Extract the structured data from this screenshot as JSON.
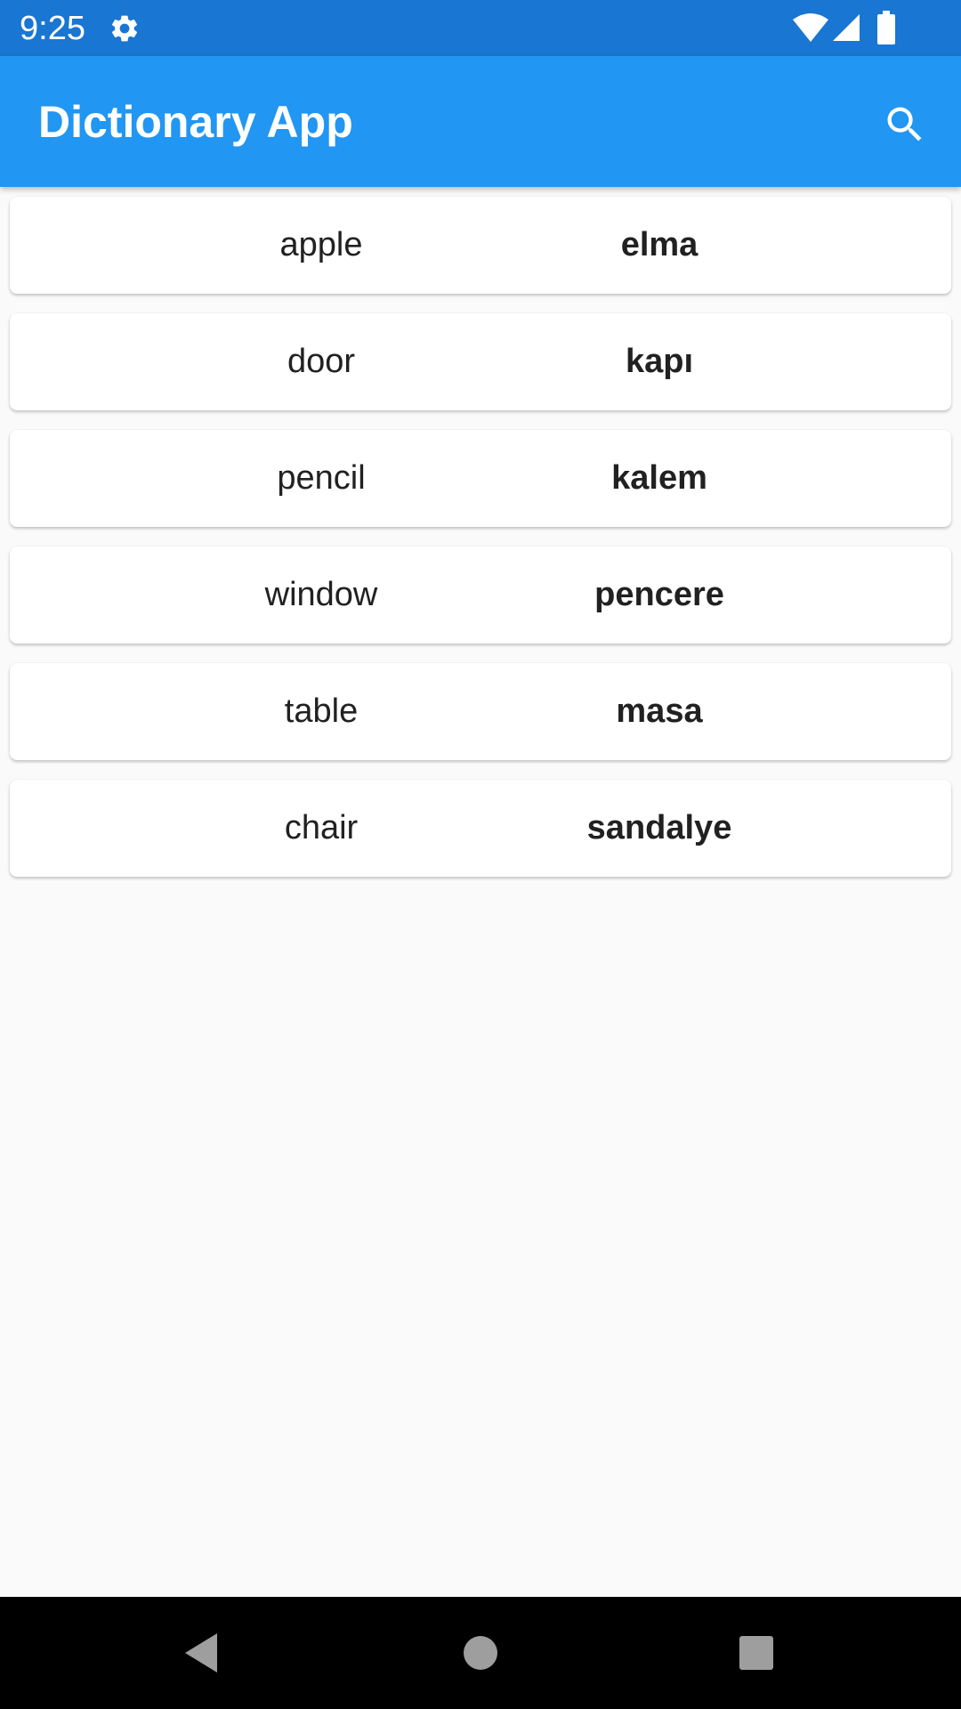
{
  "status_bar": {
    "time": "9:25",
    "icons": [
      "gear-icon",
      "wifi-icon",
      "signal-icon",
      "battery-icon"
    ]
  },
  "app_bar": {
    "title": "Dictionary App",
    "search_icon": "search-icon",
    "color": "#2196f3"
  },
  "words": [
    {
      "english": "apple",
      "turkish": "elma"
    },
    {
      "english": "door",
      "turkish": "kapı"
    },
    {
      "english": "pencil",
      "turkish": "kalem"
    },
    {
      "english": "window",
      "turkish": "pencere"
    },
    {
      "english": "table",
      "turkish": "masa"
    },
    {
      "english": "chair",
      "turkish": "sandalye"
    }
  ],
  "nav_bar": {
    "buttons": [
      "back-icon",
      "home-icon",
      "recents-icon"
    ]
  },
  "colors": {
    "status_bar": "#1976d2",
    "app_bar": "#2196f3",
    "background": "#fafafa"
  }
}
